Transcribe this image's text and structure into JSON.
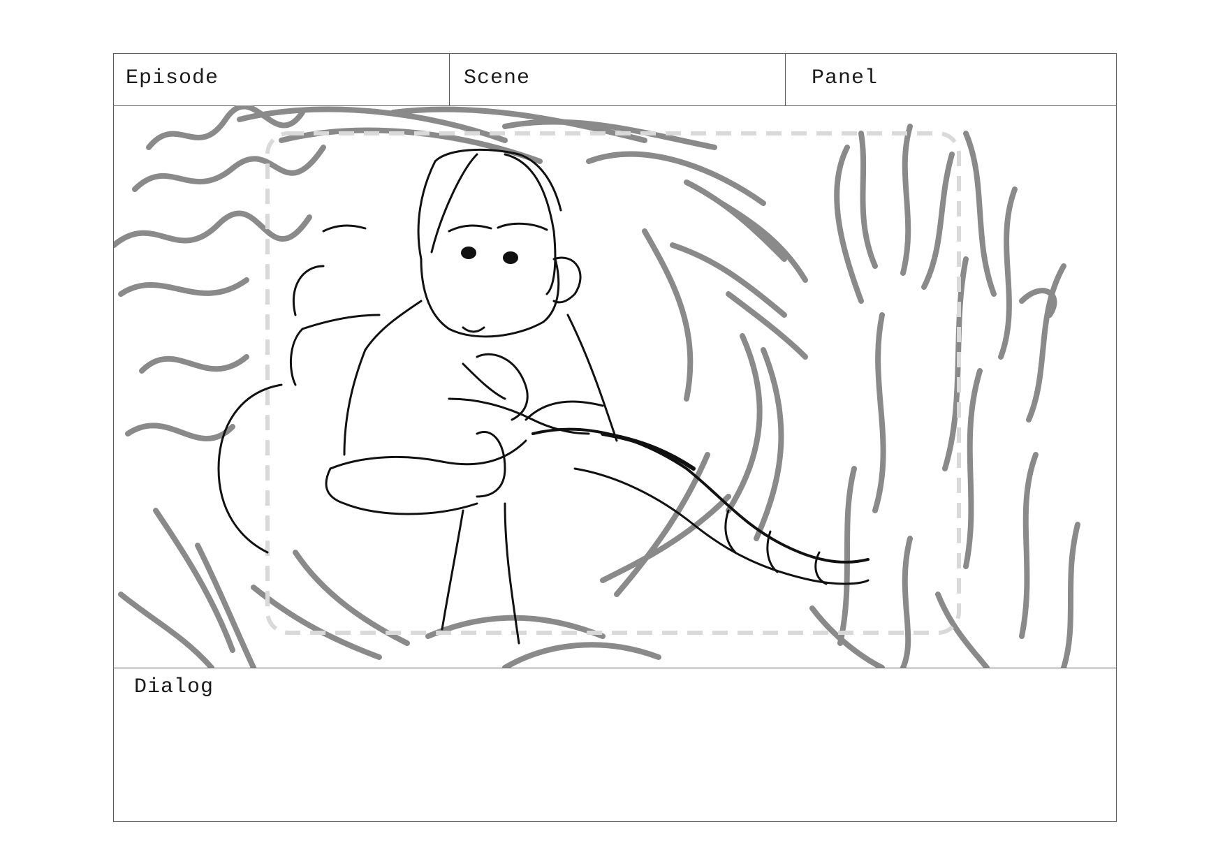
{
  "storyboard": {
    "header": {
      "episode_label": "Episode",
      "scene_label": "Scene",
      "panel_label": "Panel"
    },
    "drawing": {
      "icon": "character-sketch-icon",
      "stroke_colors": {
        "background": "#8a8a8a",
        "figure": "#111111",
        "safe_frame": "#d9d9d9"
      }
    },
    "dialog_label": "Dialog"
  }
}
